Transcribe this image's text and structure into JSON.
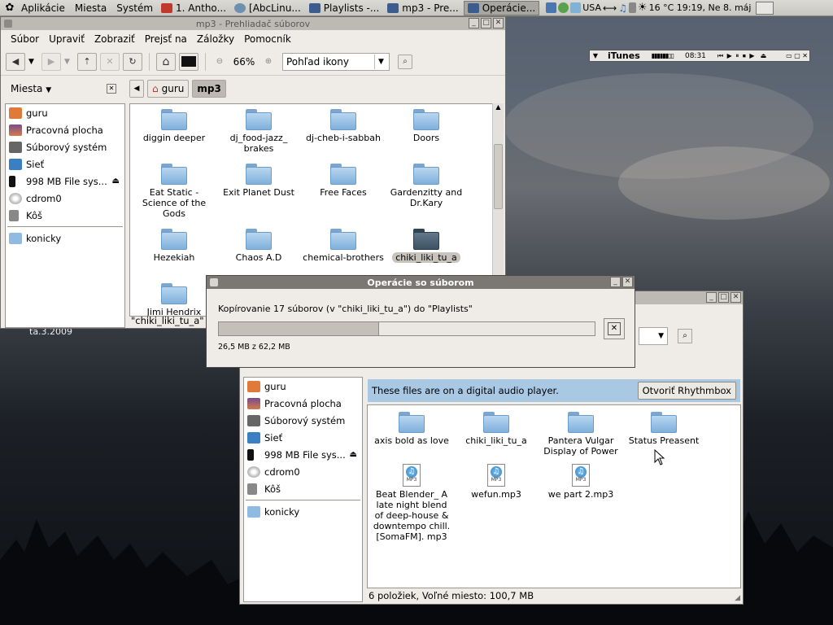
{
  "panel": {
    "menus": [
      "Aplikácie",
      "Miesta",
      "Systém"
    ],
    "tasks": [
      {
        "label": "1. Antho...",
        "active": false
      },
      {
        "label": "[AbcLinu...",
        "active": false
      },
      {
        "label": "Playlists -...",
        "active": false
      },
      {
        "label": "mp3 - Pre...",
        "active": false
      },
      {
        "label": "Operácie...",
        "active": true
      }
    ],
    "keyboard_layout": "USA",
    "weather_clock": "16 °C 19:19, Ne 8. máj"
  },
  "itunes_widget": {
    "title": "iTunes",
    "time": "08:31"
  },
  "window_main": {
    "title": "mp3 - Prehliadač súborov",
    "menu": [
      "Súbor",
      "Upraviť",
      "Zobraziť",
      "Prejsť na",
      "Záložky",
      "Pomocník"
    ],
    "zoom": "66%",
    "view_mode": "Pohľad ikony",
    "sidebar_header": "Miesta",
    "breadcrumbs": [
      "guru",
      "mp3"
    ],
    "places": [
      "guru",
      "Pracovná plocha",
      "Súborový systém",
      "Sieť",
      "998 MB File sys...",
      "cdrom0",
      "Kôš"
    ],
    "bookmarks": [
      "konicky"
    ],
    "files": [
      "diggin deeper",
      "dj_food-jazz_ brakes",
      "dj-cheb-i-sabbah",
      "Doors",
      "Eat Static - Science of the Gods",
      "Exit Planet Dust",
      "Free Faces",
      "Gardenzitty and Dr.Kary",
      "Hezekiah",
      "Chaos A.D",
      "chemical-brothers",
      "chiki_liki_tu_a",
      "Jimi Hendrix"
    ],
    "selected": "chiki_liki_tu_a",
    "status": "\"chiki_liki_tu_a\" v"
  },
  "dialog": {
    "title": "Operácie so súborom",
    "message": "Kopírovanie 17 súborov (v \"chiki_liki_tu_a\") do \"Playlists\"",
    "progress_text": "26,5 MB z 62,2 MB",
    "progress_fraction": 0.426
  },
  "window_second": {
    "places": [
      "guru",
      "Pracovná plocha",
      "Súborový systém",
      "Sieť",
      "998 MB File sys...",
      "cdrom0",
      "Kôš"
    ],
    "bookmarks": [
      "konicky"
    ],
    "info_text": "These files are on a digital audio player.",
    "info_button": "Otvoriť Rhythmbox",
    "folders": [
      "axis bold as love",
      "chiki_liki_tu_a",
      "Pantera Vulgar Display of Power",
      "Status Preasent"
    ],
    "files": [
      "Beat Blender_ A late night blend of deep-house & downtempo chill. [SomaFM]. mp3",
      "wefun.mp3",
      "we part 2.mp3"
    ],
    "status": "6 položiek, Voľné miesto: 100,7 MB"
  },
  "desktop_fragment": "ta.3.2009"
}
